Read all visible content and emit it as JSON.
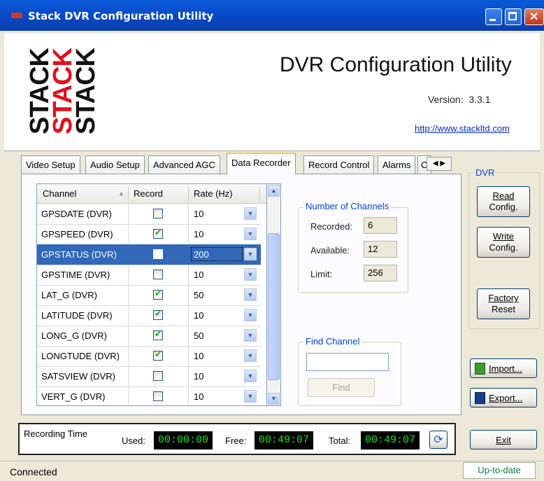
{
  "window": {
    "title": "Stack DVR Configuration Utility"
  },
  "header": {
    "logo_words": [
      "STACK",
      "STACK",
      "STACK"
    ],
    "app_title": "DVR Configuration Utility",
    "version_label": "Version:",
    "version_value": "3.3.1",
    "url": "http://www.stackltd.com"
  },
  "tabs": [
    "Video Setup",
    "Audio Setup",
    "Advanced AGC",
    "Data Recorder",
    "Record Control",
    "Alarms",
    "C"
  ],
  "active_tab": "Data Recorder",
  "table": {
    "columns": [
      "Channel",
      "Record",
      "Rate (Hz)"
    ],
    "rows": [
      {
        "channel": "GPSDATE (DVR)",
        "record": false,
        "rate": "10"
      },
      {
        "channel": "GPSPEED (DVR)",
        "record": true,
        "rate": "10"
      },
      {
        "channel": "GPSTATUS (DVR)",
        "record": false,
        "rate": "200",
        "selected": true
      },
      {
        "channel": "GPSTIME (DVR)",
        "record": false,
        "rate": "10"
      },
      {
        "channel": "LAT_G (DVR)",
        "record": true,
        "rate": "50"
      },
      {
        "channel": "LATITUDE (DVR)",
        "record": true,
        "rate": "10"
      },
      {
        "channel": "LONG_G (DVR)",
        "record": true,
        "rate": "50"
      },
      {
        "channel": "LONGTUDE (DVR)",
        "record": true,
        "rate": "10"
      },
      {
        "channel": "SATSVIEW (DVR)",
        "record": false,
        "rate": "10"
      },
      {
        "channel": "VERT_G (DVR)",
        "record": false,
        "rate": "10"
      }
    ]
  },
  "channels_group": {
    "title": "Number of Channels",
    "recorded_label": "Recorded:",
    "recorded": "6",
    "available_label": "Available:",
    "available": "12",
    "limit_label": "Limit:",
    "limit": "256"
  },
  "find_group": {
    "title": "Find Channel",
    "value": "",
    "button": "Find"
  },
  "dvr_group": {
    "title": "DVR",
    "read_line1": "Read",
    "read_line2": "Config.",
    "write_line1": "Write",
    "write_line2": "Config.",
    "reset_line1": "Factory",
    "reset_line2": "Reset",
    "import": "Import...",
    "export": "Export..."
  },
  "recording_time": {
    "title": "Recording Time",
    "used_label": "Used:",
    "used": "00:00:00",
    "free_label": "Free:",
    "free": "00:49:07",
    "total_label": "Total:",
    "total": "00:49:07"
  },
  "exit_button": "Exit",
  "status": {
    "left": "Connected",
    "right": "Up-to-date"
  },
  "colors": {
    "titlebar": "#0a5ad8",
    "selection": "#3168b8",
    "lcd_text": "#20e020",
    "logo_red": "#e0101e"
  }
}
